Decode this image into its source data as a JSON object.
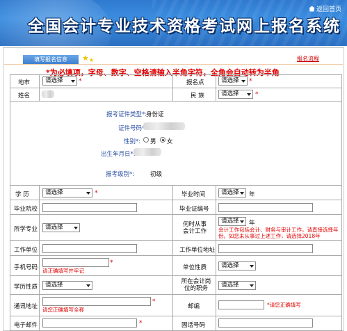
{
  "header": {
    "title": "全国会计专业技术资格考试网上报名系统",
    "home_label": "返回首页"
  },
  "tabs": {
    "active_label": "填写报名信息",
    "flow_link": "报名流程"
  },
  "notice": "*为必填项，字母、数字、空格请输入半角字符，全角会自动转为半角",
  "select_placeholder": "请选择",
  "fields": {
    "region": "地市",
    "exam_site": "报名点",
    "name": "姓名",
    "ethnicity": "民 族",
    "id_type": "报考证件类型*:",
    "id_type_value": "身份证",
    "id_number": "证件号码*:",
    "gender": "性别*:",
    "gender_male": "男",
    "gender_female": "女",
    "birth": "出生年月日*:",
    "level": "报考级别*:",
    "level_value": "初级",
    "education": "学 历",
    "grad_time": "毕业时间",
    "year": "年",
    "school": "毕业院校",
    "diploma_no": "毕业证编号",
    "major": "所学专业",
    "work_start": "何时从事会计工作",
    "work_hint": "会计工作包括会计、财务与审计工作，请直接选择年份。如您未从事过上述工作，请选择2018年",
    "employer": "工作单位",
    "employer_addr": "工作单位地址",
    "mobile": "手机号码",
    "mobile_hint": "请正确填写并牢记",
    "unit_type": "单位性质",
    "edu_type": "学历性质",
    "post": "所在会计岗位的职务",
    "address": "通讯地址",
    "address_hint": "请您正确填写全称",
    "zip": "邮编",
    "zip_hint": "*请您正确填写",
    "email": "电子邮件",
    "phone": "固话号码"
  },
  "colors": {
    "banner": "#2f7ad0",
    "required": "#e00000",
    "label_blue": "#2a4fa0"
  },
  "icons": [
    "home-icon",
    "star-icon",
    "dropdown-arrow-icon",
    "radio-icon"
  ]
}
